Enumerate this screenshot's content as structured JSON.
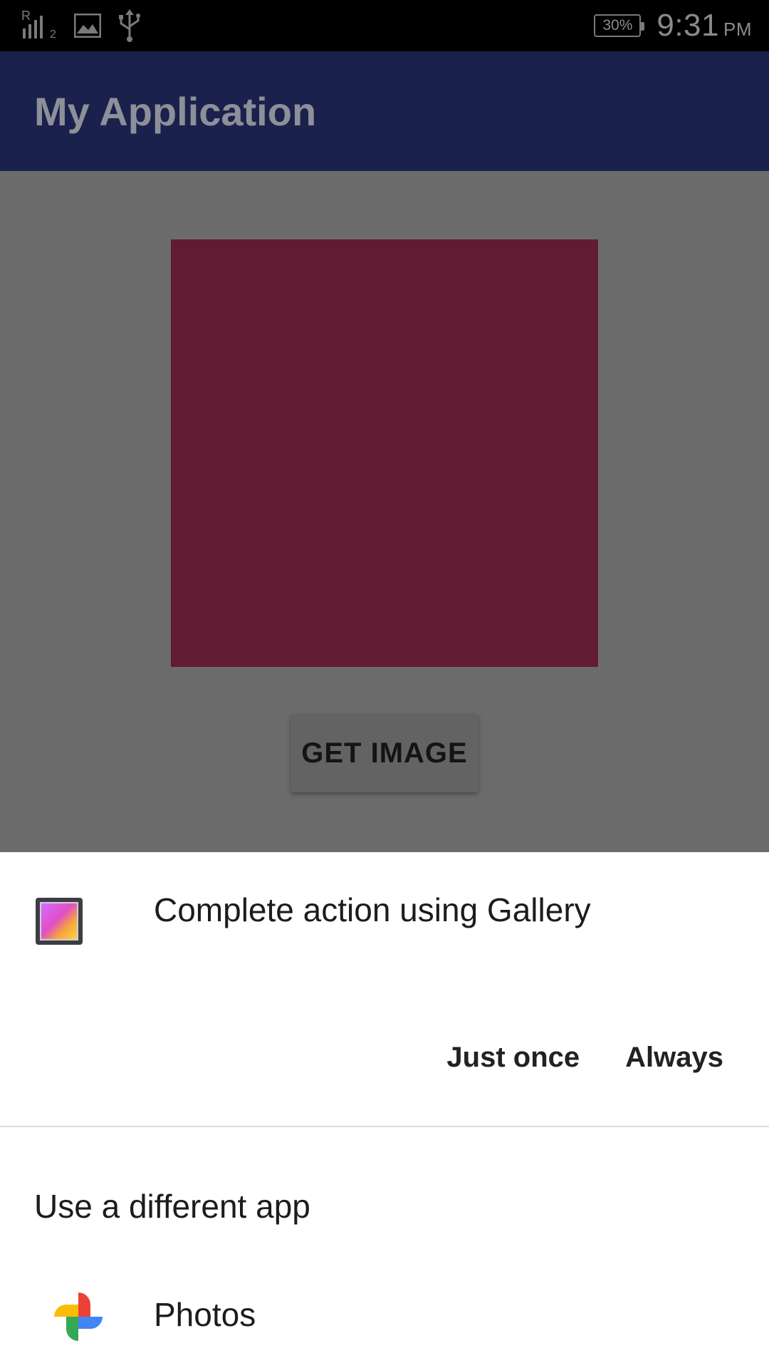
{
  "status_bar": {
    "battery": "30%",
    "time": "9:31",
    "ampm": "PM",
    "sim_label": "2",
    "icons": [
      "signal-icon",
      "image-notification-icon",
      "usb-icon",
      "battery-icon"
    ]
  },
  "app_bar": {
    "title": "My Application"
  },
  "content": {
    "image_color": "#621b33",
    "button_label": "GET IMAGE"
  },
  "sheet": {
    "title": "Complete action using Gallery",
    "just_once": "Just once",
    "always": "Always",
    "different_app": "Use a different app",
    "apps": [
      {
        "label": "Photos",
        "icon": "photos-icon"
      }
    ]
  }
}
